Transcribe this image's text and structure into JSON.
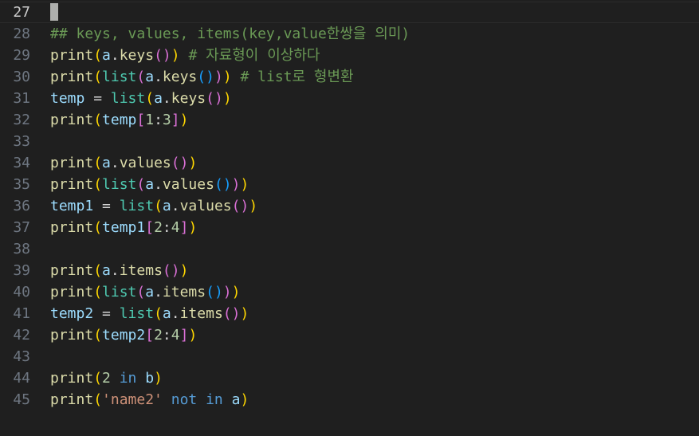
{
  "lines": [
    {
      "no": "27",
      "current": true,
      "tokens": []
    },
    {
      "no": "28",
      "tokens": [
        {
          "c": "cm",
          "t": "## keys, values, items(key,value한쌍을 의미)"
        }
      ]
    },
    {
      "no": "29",
      "tokens": [
        {
          "c": "fn",
          "t": "print"
        },
        {
          "c": "b1",
          "t": "("
        },
        {
          "c": "var",
          "t": "a"
        },
        {
          "c": "op",
          "t": "."
        },
        {
          "c": "fn",
          "t": "keys"
        },
        {
          "c": "b2",
          "t": "()"
        },
        {
          "c": "b1",
          "t": ")"
        },
        {
          "c": "op",
          "t": " "
        },
        {
          "c": "cm",
          "t": "# 자료형이 이상하다"
        }
      ]
    },
    {
      "no": "30",
      "tokens": [
        {
          "c": "fn",
          "t": "print"
        },
        {
          "c": "b1",
          "t": "("
        },
        {
          "c": "type",
          "t": "list"
        },
        {
          "c": "b2",
          "t": "("
        },
        {
          "c": "var",
          "t": "a"
        },
        {
          "c": "op",
          "t": "."
        },
        {
          "c": "fn",
          "t": "keys"
        },
        {
          "c": "b3",
          "t": "()"
        },
        {
          "c": "b2",
          "t": ")"
        },
        {
          "c": "b1",
          "t": ")"
        },
        {
          "c": "op",
          "t": " "
        },
        {
          "c": "cm",
          "t": "# list로 형변환"
        }
      ]
    },
    {
      "no": "31",
      "tokens": [
        {
          "c": "var",
          "t": "temp"
        },
        {
          "c": "op",
          "t": " = "
        },
        {
          "c": "type",
          "t": "list"
        },
        {
          "c": "b1",
          "t": "("
        },
        {
          "c": "var",
          "t": "a"
        },
        {
          "c": "op",
          "t": "."
        },
        {
          "c": "fn",
          "t": "keys"
        },
        {
          "c": "b2",
          "t": "()"
        },
        {
          "c": "b1",
          "t": ")"
        }
      ]
    },
    {
      "no": "32",
      "tokens": [
        {
          "c": "fn",
          "t": "print"
        },
        {
          "c": "b1",
          "t": "("
        },
        {
          "c": "var",
          "t": "temp"
        },
        {
          "c": "b2",
          "t": "["
        },
        {
          "c": "num",
          "t": "1"
        },
        {
          "c": "op",
          "t": ":"
        },
        {
          "c": "num",
          "t": "3"
        },
        {
          "c": "b2",
          "t": "]"
        },
        {
          "c": "b1",
          "t": ")"
        }
      ]
    },
    {
      "no": "33",
      "tokens": []
    },
    {
      "no": "34",
      "tokens": [
        {
          "c": "fn",
          "t": "print"
        },
        {
          "c": "b1",
          "t": "("
        },
        {
          "c": "var",
          "t": "a"
        },
        {
          "c": "op",
          "t": "."
        },
        {
          "c": "fn",
          "t": "values"
        },
        {
          "c": "b2",
          "t": "()"
        },
        {
          "c": "b1",
          "t": ")"
        }
      ]
    },
    {
      "no": "35",
      "tokens": [
        {
          "c": "fn",
          "t": "print"
        },
        {
          "c": "b1",
          "t": "("
        },
        {
          "c": "type",
          "t": "list"
        },
        {
          "c": "b2",
          "t": "("
        },
        {
          "c": "var",
          "t": "a"
        },
        {
          "c": "op",
          "t": "."
        },
        {
          "c": "fn",
          "t": "values"
        },
        {
          "c": "b3",
          "t": "()"
        },
        {
          "c": "b2",
          "t": ")"
        },
        {
          "c": "b1",
          "t": ")"
        }
      ]
    },
    {
      "no": "36",
      "tokens": [
        {
          "c": "var",
          "t": "temp1"
        },
        {
          "c": "op",
          "t": " = "
        },
        {
          "c": "type",
          "t": "list"
        },
        {
          "c": "b1",
          "t": "("
        },
        {
          "c": "var",
          "t": "a"
        },
        {
          "c": "op",
          "t": "."
        },
        {
          "c": "fn",
          "t": "values"
        },
        {
          "c": "b2",
          "t": "()"
        },
        {
          "c": "b1",
          "t": ")"
        }
      ]
    },
    {
      "no": "37",
      "tokens": [
        {
          "c": "fn",
          "t": "print"
        },
        {
          "c": "b1",
          "t": "("
        },
        {
          "c": "var",
          "t": "temp1"
        },
        {
          "c": "b2",
          "t": "["
        },
        {
          "c": "num",
          "t": "2"
        },
        {
          "c": "op",
          "t": ":"
        },
        {
          "c": "num",
          "t": "4"
        },
        {
          "c": "b2",
          "t": "]"
        },
        {
          "c": "b1",
          "t": ")"
        }
      ]
    },
    {
      "no": "38",
      "tokens": []
    },
    {
      "no": "39",
      "tokens": [
        {
          "c": "fn",
          "t": "print"
        },
        {
          "c": "b1",
          "t": "("
        },
        {
          "c": "var",
          "t": "a"
        },
        {
          "c": "op",
          "t": "."
        },
        {
          "c": "fn",
          "t": "items"
        },
        {
          "c": "b2",
          "t": "()"
        },
        {
          "c": "b1",
          "t": ")"
        }
      ]
    },
    {
      "no": "40",
      "tokens": [
        {
          "c": "fn",
          "t": "print"
        },
        {
          "c": "b1",
          "t": "("
        },
        {
          "c": "type",
          "t": "list"
        },
        {
          "c": "b2",
          "t": "("
        },
        {
          "c": "var",
          "t": "a"
        },
        {
          "c": "op",
          "t": "."
        },
        {
          "c": "fn",
          "t": "items"
        },
        {
          "c": "b3",
          "t": "()"
        },
        {
          "c": "b2",
          "t": ")"
        },
        {
          "c": "b1",
          "t": ")"
        }
      ]
    },
    {
      "no": "41",
      "tokens": [
        {
          "c": "var",
          "t": "temp2"
        },
        {
          "c": "op",
          "t": " = "
        },
        {
          "c": "type",
          "t": "list"
        },
        {
          "c": "b1",
          "t": "("
        },
        {
          "c": "var",
          "t": "a"
        },
        {
          "c": "op",
          "t": "."
        },
        {
          "c": "fn",
          "t": "items"
        },
        {
          "c": "b2",
          "t": "()"
        },
        {
          "c": "b1",
          "t": ")"
        }
      ]
    },
    {
      "no": "42",
      "tokens": [
        {
          "c": "fn",
          "t": "print"
        },
        {
          "c": "b1",
          "t": "("
        },
        {
          "c": "var",
          "t": "temp2"
        },
        {
          "c": "b2",
          "t": "["
        },
        {
          "c": "num",
          "t": "2"
        },
        {
          "c": "op",
          "t": ":"
        },
        {
          "c": "num",
          "t": "4"
        },
        {
          "c": "b2",
          "t": "]"
        },
        {
          "c": "b1",
          "t": ")"
        }
      ]
    },
    {
      "no": "43",
      "tokens": []
    },
    {
      "no": "44",
      "tokens": [
        {
          "c": "fn",
          "t": "print"
        },
        {
          "c": "b1",
          "t": "("
        },
        {
          "c": "num",
          "t": "2"
        },
        {
          "c": "op",
          "t": " "
        },
        {
          "c": "kw",
          "t": "in"
        },
        {
          "c": "op",
          "t": " "
        },
        {
          "c": "var",
          "t": "b"
        },
        {
          "c": "b1",
          "t": ")"
        }
      ]
    },
    {
      "no": "45",
      "tokens": [
        {
          "c": "fn",
          "t": "print"
        },
        {
          "c": "b1",
          "t": "("
        },
        {
          "c": "str",
          "t": "'name2'"
        },
        {
          "c": "op",
          "t": " "
        },
        {
          "c": "kw",
          "t": "not"
        },
        {
          "c": "op",
          "t": " "
        },
        {
          "c": "kw",
          "t": "in"
        },
        {
          "c": "op",
          "t": " "
        },
        {
          "c": "var",
          "t": "a"
        },
        {
          "c": "b1",
          "t": ")"
        }
      ]
    }
  ]
}
